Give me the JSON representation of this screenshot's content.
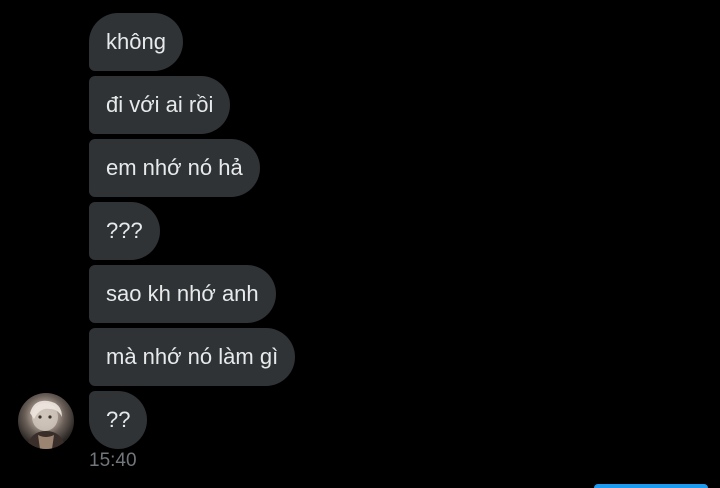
{
  "messages": [
    {
      "text": "không"
    },
    {
      "text": "đi với ai rồi"
    },
    {
      "text": "em nhớ nó hả"
    },
    {
      "text": "???"
    },
    {
      "text": "sao kh nhớ anh"
    },
    {
      "text": "mà nhớ nó làm gì"
    },
    {
      "text": "??"
    }
  ],
  "timestamp": "15:40",
  "colors": {
    "background": "#000000",
    "bubble": "#2f3336",
    "text": "#e7e9ea",
    "timestamp": "#71767b",
    "accent": "#1d9bf0"
  }
}
